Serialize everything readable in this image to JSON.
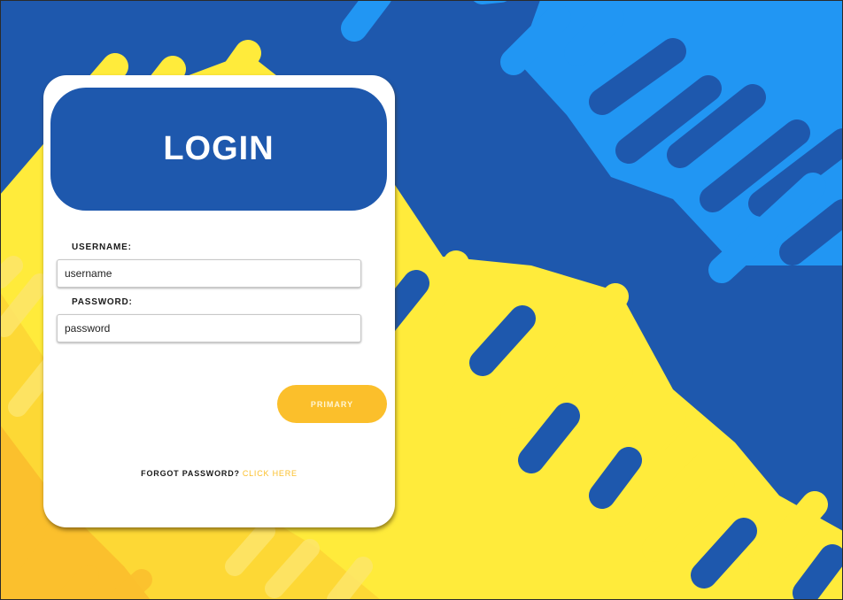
{
  "login": {
    "title": "LOGIN",
    "username_label": "USERNAME:",
    "username_placeholder": "username",
    "password_label": "PASSWORD:",
    "password_placeholder": "password",
    "primary_button": "PRIMARY",
    "forgot_text": "FORGOT PASSWORD?",
    "forgot_link": "CLICK HERE"
  },
  "colors": {
    "background_blue": "#1e58ad",
    "light_blue": "#2196f3",
    "yellow": "#ffeb3b",
    "accent": "#fbbf2b"
  }
}
